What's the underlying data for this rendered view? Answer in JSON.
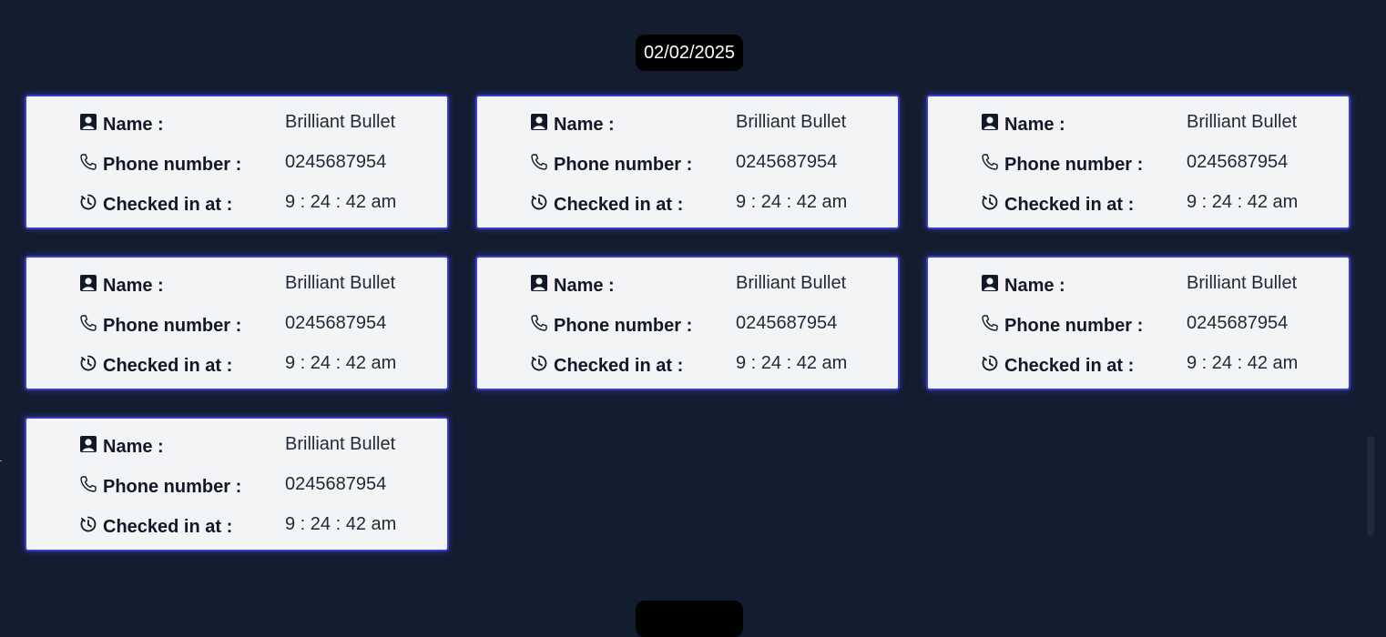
{
  "date_badge": "02/02/2025",
  "labels": {
    "name": "Name :",
    "phone": "Phone number :",
    "checked_in": "Checked in at :"
  },
  "cards": [
    {
      "name": "Brilliant Bullet",
      "phone": "0245687954",
      "checked_in": "9 : 24 : 42 am"
    },
    {
      "name": "Brilliant Bullet",
      "phone": "0245687954",
      "checked_in": "9 : 24 : 42 am"
    },
    {
      "name": "Brilliant Bullet",
      "phone": "0245687954",
      "checked_in": "9 : 24 : 42 am"
    },
    {
      "name": "Brilliant Bullet",
      "phone": "0245687954",
      "checked_in": "9 : 24 : 42 am"
    },
    {
      "name": "Brilliant Bullet",
      "phone": "0245687954",
      "checked_in": "9 : 24 : 42 am"
    },
    {
      "name": "Brilliant Bullet",
      "phone": "0245687954",
      "checked_in": "9 : 24 : 42 am"
    },
    {
      "name": "Brilliant Bullet",
      "phone": "0245687954",
      "checked_in": "9 : 24 : 42 am"
    }
  ],
  "icons": {
    "name": "person-icon",
    "phone": "phone-icon",
    "checked_in": "clock-icon"
  },
  "colors": {
    "background": "#121d2f",
    "card": "#f3f4f6",
    "card_border": "#3b3bd0",
    "badge": "#000000"
  }
}
